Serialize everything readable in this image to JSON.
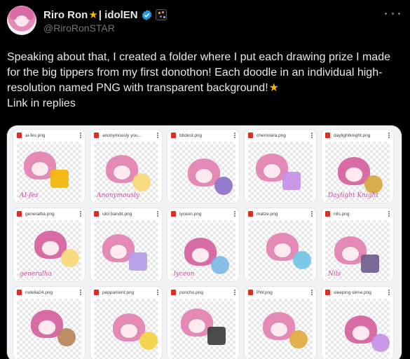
{
  "author": {
    "display_name": "Riro Ron",
    "name_suffix": "| idolEN",
    "handle": "@RiroRonSTAR"
  },
  "tweet": {
    "text": "Speaking about that, I created a folder where I put each drawing prize I made for the big tippers from my first donothon! Each doodle in an individual high-resolution named PNG with transparent background!",
    "text_tail": "Link in replies"
  },
  "media": {
    "files": [
      {
        "name": "ai-fes.png",
        "caption": "AI-fes",
        "hair": "#e58ab6",
        "accent": "#f4b400"
      },
      {
        "name": "anonymously you...",
        "caption": "Anonymously",
        "hair": "#e58ab6",
        "accent": "#f7d774"
      },
      {
        "name": "bbdest.png",
        "caption": "",
        "hair": "#e58ab6",
        "accent": "#8b6fc9"
      },
      {
        "name": "cherrolara.png",
        "caption": "",
        "hair": "#e58ab6",
        "accent": "#c48ee6"
      },
      {
        "name": "daylightknight.png",
        "caption": "Daylight Knight",
        "hair": "#d86aa4",
        "accent": "#d6a53a"
      },
      {
        "name": "generalha.png",
        "caption": "generalha",
        "hair": "#d86aa4",
        "accent": "#f7d774"
      },
      {
        "name": "idol bandit.png",
        "caption": "",
        "hair": "#e58ab6",
        "accent": "#b49be8"
      },
      {
        "name": "lyceon.png",
        "caption": "lyceon",
        "hair": "#d86aa4",
        "accent": "#7ab8e8"
      },
      {
        "name": "matze.png",
        "caption": "",
        "hair": "#e58ab6",
        "accent": "#6fc3e8"
      },
      {
        "name": "nils.png",
        "caption": "Nils",
        "hair": "#e58ab6",
        "accent": "#6a5a8c"
      },
      {
        "name": "nutella24.png",
        "caption": "",
        "hair": "#d86aa4",
        "accent": "#b5835a"
      },
      {
        "name": "peppament.png",
        "caption": "",
        "hair": "#e58ab6",
        "accent": "#f4d03f"
      },
      {
        "name": "poncho.png",
        "caption": "",
        "hair": "#e58ab6",
        "accent": "#3a3a3a"
      },
      {
        "name": "PW.png",
        "caption": "",
        "hair": "#e58ab6",
        "accent": "#e0a93a"
      },
      {
        "name": "sleeping slime.png",
        "caption": "",
        "hair": "#d86aa4",
        "accent": "#c48ee6"
      }
    ]
  }
}
